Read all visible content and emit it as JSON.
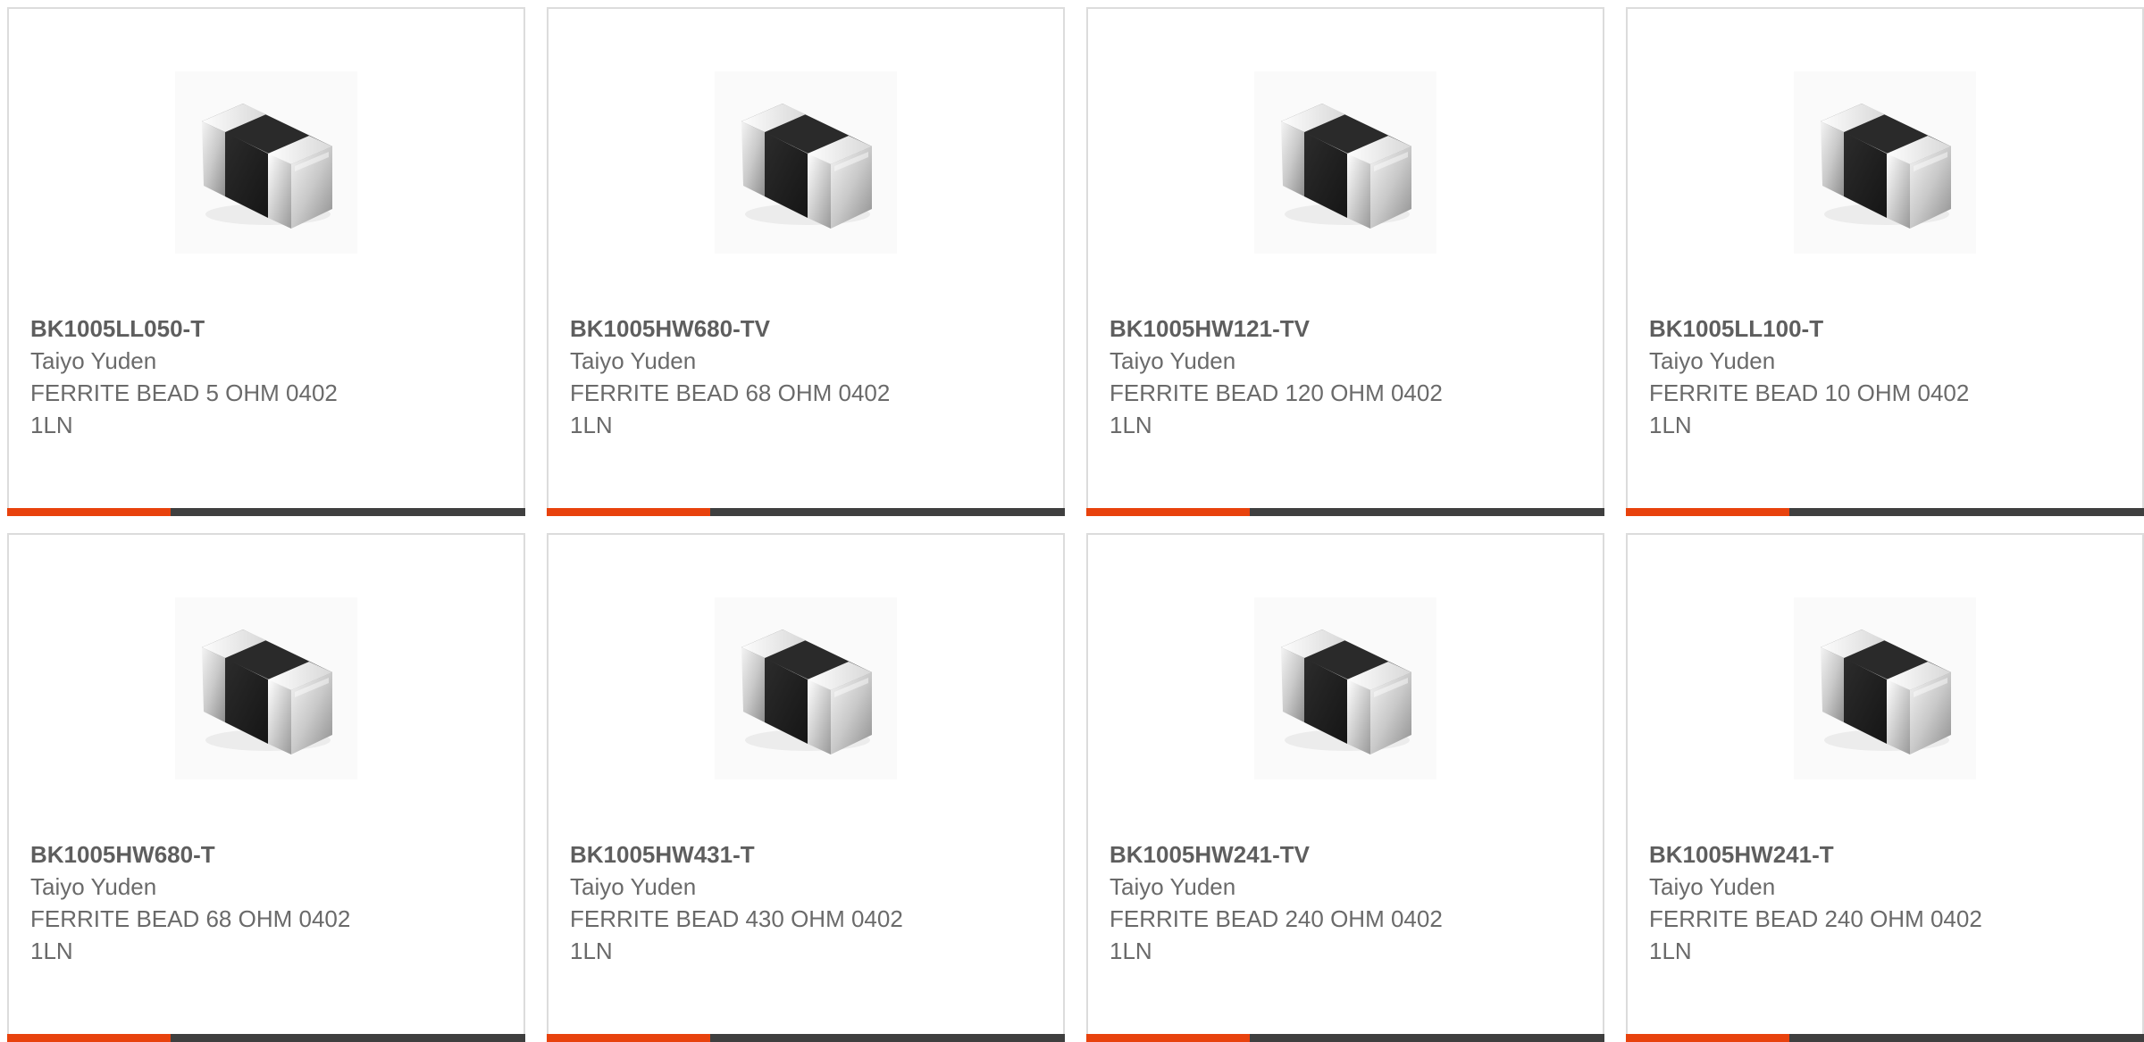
{
  "colors": {
    "accent": "#e8420d",
    "bar_dark": "#3f3f3f",
    "border": "#dcdcdc",
    "text": "#666666"
  },
  "products": [
    {
      "part": "BK1005LL050-T",
      "maker": "Taiyo Yuden",
      "desc": "FERRITE BEAD 5 OHM 0402",
      "lines": "1LN",
      "image": "ferrite-bead-chip-icon"
    },
    {
      "part": "BK1005HW680-TV",
      "maker": "Taiyo Yuden",
      "desc": "FERRITE BEAD 68 OHM 0402",
      "lines": "1LN",
      "image": "ferrite-bead-chip-icon"
    },
    {
      "part": "BK1005HW121-TV",
      "maker": "Taiyo Yuden",
      "desc": "FERRITE BEAD 120 OHM 0402",
      "lines": "1LN",
      "image": "ferrite-bead-chip-icon"
    },
    {
      "part": "BK1005LL100-T",
      "maker": "Taiyo Yuden",
      "desc": "FERRITE BEAD 10 OHM 0402",
      "lines": "1LN",
      "image": "ferrite-bead-chip-icon"
    },
    {
      "part": "BK1005HW680-T",
      "maker": "Taiyo Yuden",
      "desc": "FERRITE BEAD 68 OHM 0402",
      "lines": "1LN",
      "image": "ferrite-bead-chip-icon"
    },
    {
      "part": "BK1005HW431-T",
      "maker": "Taiyo Yuden",
      "desc": "FERRITE BEAD 430 OHM 0402",
      "lines": "1LN",
      "image": "ferrite-bead-chip-icon"
    },
    {
      "part": "BK1005HW241-TV",
      "maker": "Taiyo Yuden",
      "desc": "FERRITE BEAD 240 OHM 0402",
      "lines": "1LN",
      "image": "ferrite-bead-chip-icon"
    },
    {
      "part": "BK1005HW241-T",
      "maker": "Taiyo Yuden",
      "desc": "FERRITE BEAD 240 OHM 0402",
      "lines": "1LN",
      "image": "ferrite-bead-chip-icon"
    }
  ]
}
